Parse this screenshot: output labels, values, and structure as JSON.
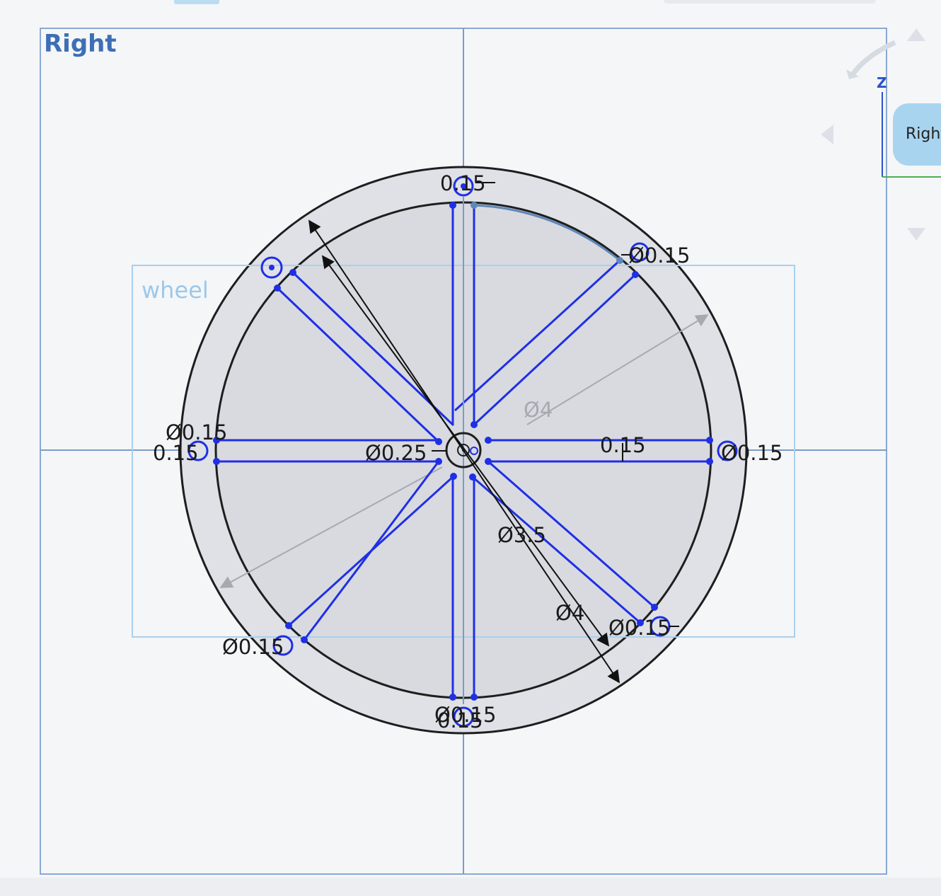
{
  "view": {
    "plane_label": "Right",
    "sketch_label": "wheel"
  },
  "dimensions": {
    "top_width": "0.15",
    "top_right_dia": "Ø0.15",
    "left_dia": "Ø0.15",
    "left_width": "0.15",
    "center_dia": "Ø0.25",
    "inner_dia_grey": "Ø4",
    "right_width": "0.15",
    "right_dia": "Ø0.15",
    "inner_dia": "Ø3.5",
    "outer_dia": "Ø4",
    "bottom_right_dia": "Ø0.15",
    "bottom_left_dia": "Ø0.15",
    "bottom_dia": "Ø0.15",
    "bottom_width": "0.15"
  },
  "view_cube": {
    "face_label": "Right",
    "axis_label": "Z"
  },
  "colors": {
    "sketch_blue": "#1f2fe6",
    "plane_blue": "#3c6fb5",
    "wheel_fill": "#dfe1e6",
    "cube_face": "#a9d4ef"
  }
}
